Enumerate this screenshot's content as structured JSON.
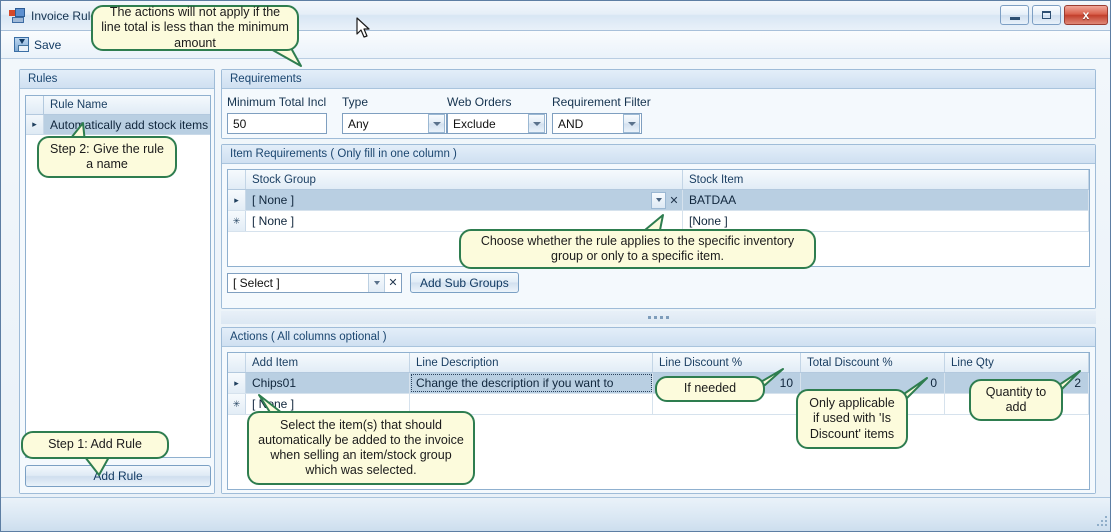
{
  "window": {
    "title": "Invoice Rule",
    "icon": "app-window-icon",
    "minimize_label": "Minimize",
    "maximize_label": "Maximize",
    "close_label": "x"
  },
  "toolbar": {
    "save_label": "Save",
    "save_icon": "save-disk-icon"
  },
  "rules_panel": {
    "group_title": "Rules",
    "column_header": "Rule Name",
    "rows": [
      {
        "indicator": "▸",
        "name": "Automatically add stock items"
      }
    ],
    "add_rule_label": "Add Rule"
  },
  "requirements": {
    "group_title": "Requirements",
    "fields": [
      {
        "label": "Minimum Total Incl",
        "value": "50",
        "type": "textbox"
      },
      {
        "label": "Type",
        "value": "Any",
        "type": "combo"
      },
      {
        "label": "Web Orders",
        "value": "Exclude",
        "type": "combo"
      },
      {
        "label": "Requirement Filter",
        "value": "AND",
        "type": "combo"
      }
    ]
  },
  "item_requirements": {
    "group_title": "Item Requirements ( Only fill in one column )",
    "columns": [
      "Stock Group",
      "Stock Item"
    ],
    "rows": [
      {
        "indicator": "▸",
        "stock_group": "[ None ]",
        "stock_item": "BATDAA",
        "selected": true
      },
      {
        "indicator": "✳",
        "stock_group": "[ None ]",
        "stock_item": "[None ]",
        "selected": false
      }
    ],
    "sub_select_value": "[ Select ]",
    "add_sub_groups_label": "Add Sub Groups"
  },
  "actions": {
    "group_title": "Actions ( All columns optional )",
    "columns": [
      "Add Item",
      "Line Description",
      "Line Discount %",
      "Total Discount %",
      "Line Qty"
    ],
    "rows": [
      {
        "indicator": "▸",
        "add_item": "Chips01",
        "line_description": "Change the description if you want to",
        "line_discount": "10",
        "total_discount": "0",
        "line_qty": "2",
        "selected": true
      },
      {
        "indicator": "✳",
        "add_item": "[ None ]",
        "line_description": "",
        "line_discount": "",
        "total_discount": "",
        "line_qty": "",
        "selected": false
      }
    ]
  },
  "callouts": [
    {
      "id": "min-amount",
      "text": "The actions will not apply if the line total is less than the minimum amount"
    },
    {
      "id": "step2-name",
      "text": "Step 2:  Give the rule a name"
    },
    {
      "id": "stock-choice",
      "text": "Choose whether the rule applies to the specific inventory group or only to a specific item."
    },
    {
      "id": "step1-add",
      "text": "Step 1: Add Rule"
    },
    {
      "id": "select-items",
      "text": "Select the item(s) that should automatically be added to the invoice when selling an item/stock group which was selected."
    },
    {
      "id": "if-needed",
      "text": "If needed"
    },
    {
      "id": "is-discount",
      "text": "Only applicable if used with 'Is Discount' items"
    },
    {
      "id": "quantity",
      "text": "Quantity to add"
    }
  ],
  "colors": {
    "callout_fill": "#fcfbdc",
    "callout_border": "#2e7d4f",
    "selection": "#b9cfe2",
    "accent": "#1b4670",
    "close_button": "#c23f2c"
  }
}
